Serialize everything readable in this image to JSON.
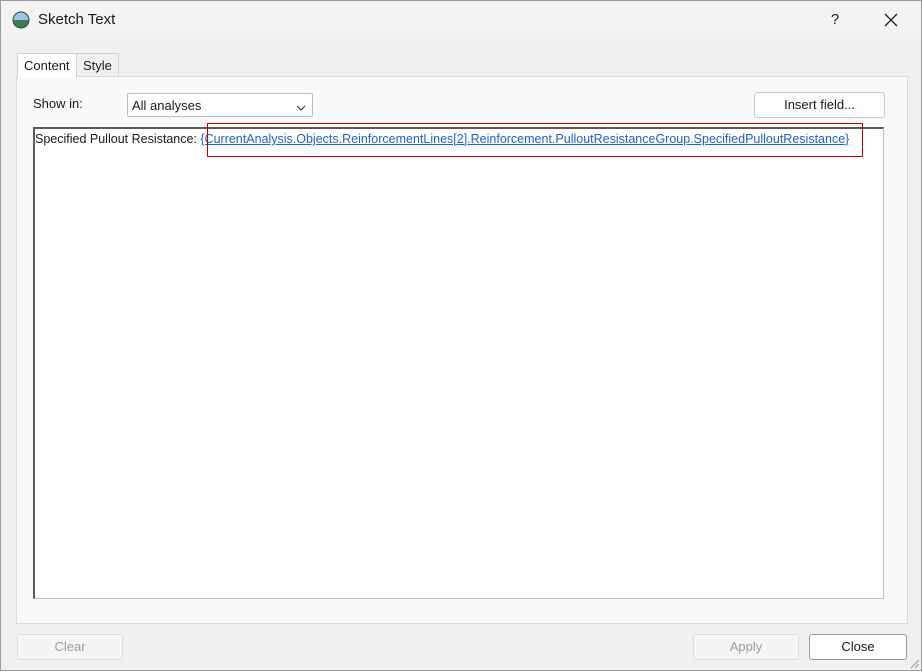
{
  "window": {
    "title": "Sketch Text",
    "help_label": "?"
  },
  "tabs": [
    {
      "label": "Content",
      "active": true
    },
    {
      "label": "Style",
      "active": false
    }
  ],
  "content": {
    "show_in_label": "Show in:",
    "show_in_value": "All analyses",
    "insert_field_label": "Insert field...",
    "editor_text_prefix": "Specified Pullout Resistance: ",
    "editor_field_code": "{CurrentAnalysis.Objects.ReinforcementLines[2].Reinforcement.PulloutResistanceGroup.SpecifiedPulloutResistance}"
  },
  "footer": {
    "clear_label": "Clear",
    "apply_label": "Apply",
    "close_label": "Close"
  },
  "icons": {
    "app": "globe-icon",
    "help": "help-icon",
    "close": "close-icon",
    "dropdown": "chevron-down-icon",
    "resize": "resize-grip-icon"
  },
  "colors": {
    "highlight_border": "#c00000",
    "link": "#1f5fd1"
  }
}
